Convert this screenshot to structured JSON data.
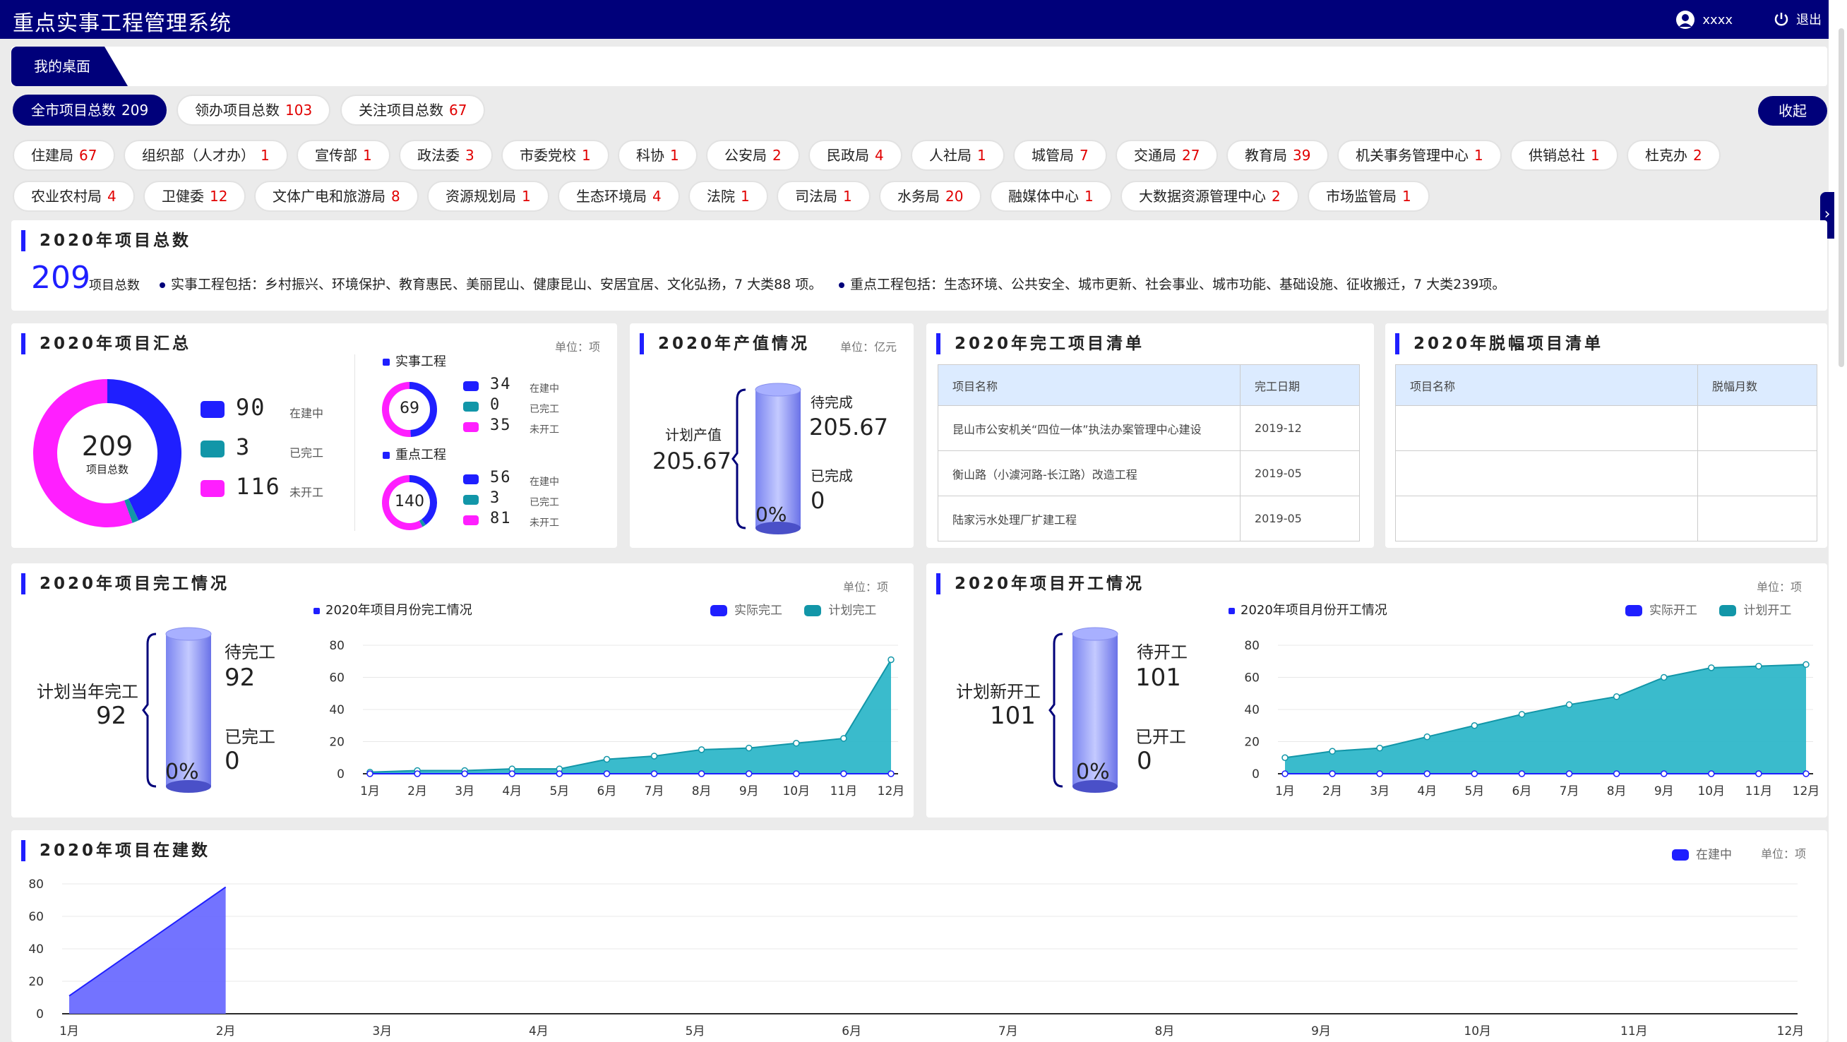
{
  "header": {
    "title": "重点实事工程管理系统",
    "user": "xxxx",
    "logout": "退出"
  },
  "tab": {
    "label": "我的桌面"
  },
  "summary_chips": [
    {
      "label": "全市项目总数",
      "count": "209"
    },
    {
      "label": "领办项目总数",
      "count": "103"
    },
    {
      "label": "关注项目总数",
      "count": "67"
    }
  ],
  "collapse_label": "收起",
  "dept_chips_row1": [
    {
      "label": "住建局",
      "count": "67"
    },
    {
      "label": "组织部（人才办）",
      "count": "1"
    },
    {
      "label": "宣传部",
      "count": "1"
    },
    {
      "label": "政法委",
      "count": "3"
    },
    {
      "label": "市委党校",
      "count": "1"
    },
    {
      "label": "科协",
      "count": "1"
    },
    {
      "label": "公安局",
      "count": "2"
    },
    {
      "label": "民政局",
      "count": "4"
    },
    {
      "label": "人社局",
      "count": "1"
    },
    {
      "label": "城管局",
      "count": "7"
    },
    {
      "label": "交通局",
      "count": "27"
    },
    {
      "label": "教育局",
      "count": "39"
    },
    {
      "label": "机关事务管理中心",
      "count": "1"
    },
    {
      "label": "供销总社",
      "count": "1"
    },
    {
      "label": "杜克办",
      "count": "2"
    }
  ],
  "dept_chips_row2": [
    {
      "label": "农业农村局",
      "count": "4"
    },
    {
      "label": "卫健委",
      "count": "12"
    },
    {
      "label": "文体广电和旅游局",
      "count": "8"
    },
    {
      "label": "资源规划局",
      "count": "1"
    },
    {
      "label": "生态环境局",
      "count": "4"
    },
    {
      "label": "法院",
      "count": "1"
    },
    {
      "label": "司法局",
      "count": "1"
    },
    {
      "label": "水务局",
      "count": "20"
    },
    {
      "label": "融媒体中心",
      "count": "1"
    },
    {
      "label": "大数据资源管理中心",
      "count": "2"
    },
    {
      "label": "市场监管局",
      "count": "1"
    }
  ],
  "total_panel": {
    "title": "2020年项目总数",
    "number": "209",
    "number_label": "项目总数",
    "note1": "实事工程包括：乡村振兴、环境保护、教育惠民、美丽昆山、健康昆山、安居宜居、文化弘扬，7 大类88 项。",
    "note2": "重点工程包括：生态环境、公共安全、城市更新、社会事业、城市功能、基础设施、征收搬迁，7 大类239项。"
  },
  "summary_panel": {
    "title": "2020年项目汇总",
    "unit": "单位：项",
    "donut": {
      "total": "209",
      "label": "项目总数",
      "values": [
        90,
        3,
        116
      ]
    },
    "legend": [
      {
        "value": "90",
        "label": "在建中",
        "color": "#1f1fff"
      },
      {
        "value": "3",
        "label": "已完工",
        "color": "#1296a8"
      },
      {
        "value": "116",
        "label": "未开工",
        "color": "#ff1fff"
      }
    ],
    "shishi": {
      "title": "实事工程",
      "total": "69",
      "values": [
        34,
        0,
        35
      ],
      "labels": [
        "34",
        "0",
        "35"
      ]
    },
    "zhongdian": {
      "title": "重点工程",
      "total": "140",
      "values": [
        56,
        3,
        81
      ],
      "labels": [
        "56",
        "3",
        "81"
      ]
    },
    "sub_legend_labels": [
      "在建中",
      "已完工",
      "未开工"
    ]
  },
  "output_panel": {
    "title": "2020年产值情况",
    "unit": "单位：亿元",
    "planned_label": "计划产值",
    "planned": "205.67",
    "pending_label": "待完成",
    "pending": "205.67",
    "done_label": "已完成",
    "done": "0",
    "percent": "0%",
    "fill": 0
  },
  "completed_list": {
    "title": "2020年完工项目清单",
    "headers": [
      "项目名称",
      "完工日期"
    ],
    "rows": [
      [
        "昆山市公安机关“四位一体”执法办案管理中心建设",
        "2019-12"
      ],
      [
        "衡山路（小澞河路-长江路）改造工程",
        "2019-05"
      ],
      [
        "陆家污水处理厂扩建工程",
        "2019-05"
      ]
    ]
  },
  "delayed_list": {
    "title": "2020年脱幅项目清单",
    "headers": [
      "项目名称",
      "脱幅月数"
    ]
  },
  "completion_panel": {
    "title": "2020年项目完工情况",
    "unit": "单位：项",
    "planned_label": "计划当年完工",
    "planned": "92",
    "pending_label": "待完工",
    "pending": "92",
    "done_label": "已完工",
    "done": "0",
    "percent": "0%",
    "fill": 0,
    "chart_title": "2020年项目月份完工情况",
    "legend": [
      "实际完工",
      "计划完工"
    ]
  },
  "start_panel": {
    "title": "2020年项目开工情况",
    "unit": "单位：项",
    "planned_label": "计划新开工",
    "planned": "101",
    "pending_label": "待开工",
    "pending": "101",
    "done_label": "已开工",
    "done": "0",
    "percent": "0%",
    "fill": 0,
    "chart_title": "2020年项目月份开工情况",
    "legend": [
      "实际开工",
      "计划开工"
    ]
  },
  "construction_panel": {
    "title": "2020年项目在建数",
    "legend": "在建中",
    "unit": "单位：项"
  },
  "chart_data": [
    {
      "type": "area",
      "title": "2020年项目月份完工情况",
      "categories": [
        "1月",
        "2月",
        "3月",
        "4月",
        "5月",
        "6月",
        "7月",
        "8月",
        "9月",
        "10月",
        "11月",
        "12月"
      ],
      "ylim": [
        0,
        80
      ],
      "yticks": [
        0,
        20,
        40,
        60,
        80
      ],
      "series": [
        {
          "name": "实际完工",
          "values": [
            0,
            0,
            0,
            0,
            0,
            0,
            0,
            0,
            0,
            0,
            0,
            0
          ],
          "color": "#1f1fff"
        },
        {
          "name": "计划完工",
          "values": [
            1,
            2,
            2,
            3,
            3,
            9,
            11,
            15,
            16,
            19,
            22,
            71
          ],
          "color": "#1296a8"
        }
      ]
    },
    {
      "type": "area",
      "title": "2020年项目月份开工情况",
      "categories": [
        "1月",
        "2月",
        "3月",
        "4月",
        "5月",
        "6月",
        "7月",
        "8月",
        "9月",
        "10月",
        "11月",
        "12月"
      ],
      "ylim": [
        0,
        80
      ],
      "yticks": [
        0,
        20,
        40,
        60,
        80
      ],
      "series": [
        {
          "name": "实际开工",
          "values": [
            0,
            0,
            0,
            0,
            0,
            0,
            0,
            0,
            0,
            0,
            0,
            0
          ],
          "color": "#1f1fff"
        },
        {
          "name": "计划开工",
          "values": [
            10,
            14,
            16,
            23,
            30,
            37,
            43,
            48,
            60,
            66,
            67,
            68
          ],
          "color": "#1296a8"
        }
      ]
    },
    {
      "type": "area",
      "title": "2020年项目在建数",
      "categories": [
        "1月",
        "2月",
        "3月",
        "4月",
        "5月",
        "6月",
        "7月",
        "8月",
        "9月",
        "10月",
        "11月",
        "12月"
      ],
      "ylim": [
        0,
        80
      ],
      "yticks": [
        0,
        20,
        40,
        60,
        80
      ],
      "series": [
        {
          "name": "在建中",
          "values": [
            11,
            78
          ],
          "color": "#1f1fff"
        }
      ]
    }
  ]
}
